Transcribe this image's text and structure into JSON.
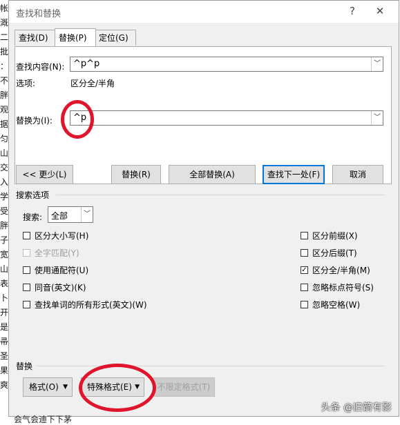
{
  "doc_edge": [
    "帐",
    "溉",
    "二",
    "批",
    "：",
    "不",
    "胖",
    "观",
    "据",
    "匀",
    "山",
    "交",
    "入",
    "学",
    "受",
    "胖",
    "子",
    "宽",
    "山",
    "表",
    "卜",
    "开",
    "是",
    "帚",
    "圣",
    "果",
    "爽"
  ],
  "window": {
    "title": "查找和替换",
    "help": "?",
    "close": "✕"
  },
  "tabs": [
    {
      "label": "查找(D)"
    },
    {
      "label": "替换(P)"
    },
    {
      "label": "定位(G)"
    }
  ],
  "find": {
    "label": "查找内容(N):",
    "value": "^p^p",
    "options_label": "选项:",
    "options_value": "区分全/半角"
  },
  "replace": {
    "label": "替换为(I):",
    "value": "^p"
  },
  "buttons": {
    "less": "<< 更少(L)",
    "replace": "替换(R)",
    "replace_all": "全部替换(A)",
    "find_next": "查找下一处(F)",
    "cancel": "取消"
  },
  "search_options": {
    "title": "搜索选项",
    "search_label": "搜索:",
    "search_value": "全部",
    "left": [
      {
        "label": "区分大小写(H)",
        "checked": false,
        "disabled": false
      },
      {
        "label": "全字匹配(Y)",
        "checked": false,
        "disabled": true
      },
      {
        "label": "使用通配符(U)",
        "checked": false,
        "disabled": false
      },
      {
        "label": "同音(英文)(K)",
        "checked": false,
        "disabled": false
      },
      {
        "label": "查找单词的所有形式(英文)(W)",
        "checked": false,
        "disabled": false
      }
    ],
    "right": [
      {
        "label": "区分前缀(X)",
        "checked": false
      },
      {
        "label": "区分后缀(T)",
        "checked": false
      },
      {
        "label": "区分全/半角(M)",
        "checked": true
      },
      {
        "label": "忽略标点符号(S)",
        "checked": false
      },
      {
        "label": "忽略空格(W)",
        "checked": false
      }
    ]
  },
  "replace_group": {
    "title": "替换",
    "format": "格式(O)",
    "special": "特殊格式(E)",
    "no_format": "不限定格式(T)"
  },
  "watermark": "头条 @旧箭有影",
  "bottom_text": "会气会迪下下茅",
  "colors": {
    "annotation": "#e0142a",
    "accent": "#0078d7"
  }
}
